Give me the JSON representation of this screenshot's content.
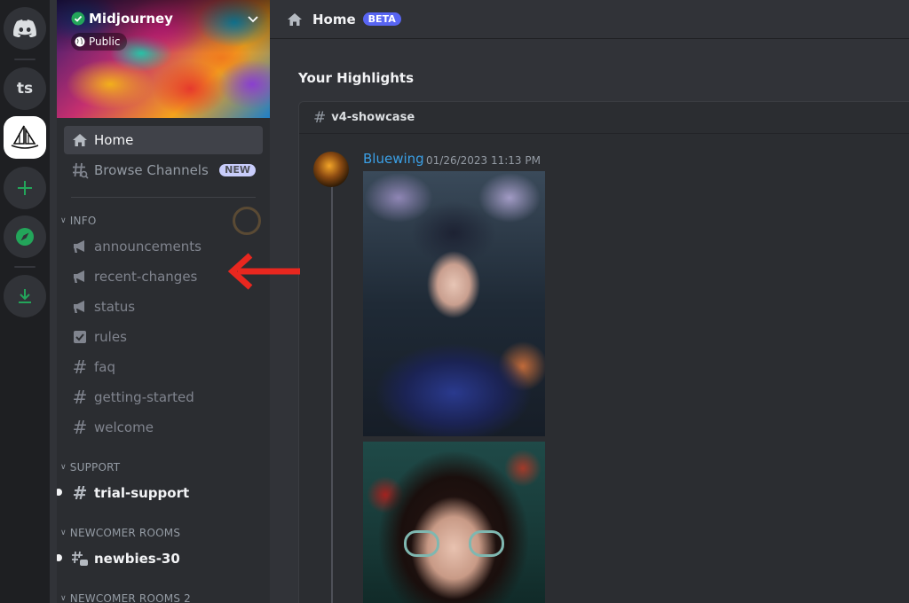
{
  "colors": {
    "accent": "#5865f2",
    "green": "#23a55a",
    "arrow": "#e8271f",
    "author": "#3ba0e6"
  },
  "rail": {
    "items": [
      {
        "name": "discord-home",
        "icon": "discord-logo-icon"
      },
      {
        "name": "server-ts",
        "label": "ts"
      },
      {
        "name": "server-midjourney",
        "icon": "sailboat-icon"
      },
      {
        "name": "add-server",
        "icon": "plus-icon"
      },
      {
        "name": "explore",
        "icon": "compass-icon"
      },
      {
        "name": "download",
        "icon": "download-icon"
      }
    ]
  },
  "server": {
    "name": "Midjourney",
    "visibility": "Public"
  },
  "sidebar": {
    "home_label": "Home",
    "browse_label": "Browse Channels",
    "browse_badge": "NEW",
    "categories": [
      {
        "name": "INFO",
        "channels": [
          {
            "name": "announcements",
            "icon": "megaphone-icon"
          },
          {
            "name": "recent-changes",
            "icon": "megaphone-icon"
          },
          {
            "name": "status",
            "icon": "megaphone-icon"
          },
          {
            "name": "rules",
            "icon": "checklist-icon"
          },
          {
            "name": "faq",
            "icon": "hash-icon"
          },
          {
            "name": "getting-started",
            "icon": "hash-icon"
          },
          {
            "name": "welcome",
            "icon": "hash-icon"
          }
        ]
      },
      {
        "name": "SUPPORT",
        "channels": [
          {
            "name": "trial-support",
            "icon": "hash-icon",
            "unread": true
          }
        ]
      },
      {
        "name": "NEWCOMER ROOMS",
        "channels": [
          {
            "name": "newbies-30",
            "icon": "threads-icon",
            "unread": true
          }
        ]
      },
      {
        "name": "NEWCOMER ROOMS 2",
        "channels": []
      }
    ]
  },
  "main": {
    "title": "Home",
    "badge": "BETA",
    "section_title": "Your Highlights",
    "card": {
      "channel": "v4-showcase",
      "author": "Bluewing",
      "timestamp": "01/26/2023 11:13 PM"
    }
  }
}
